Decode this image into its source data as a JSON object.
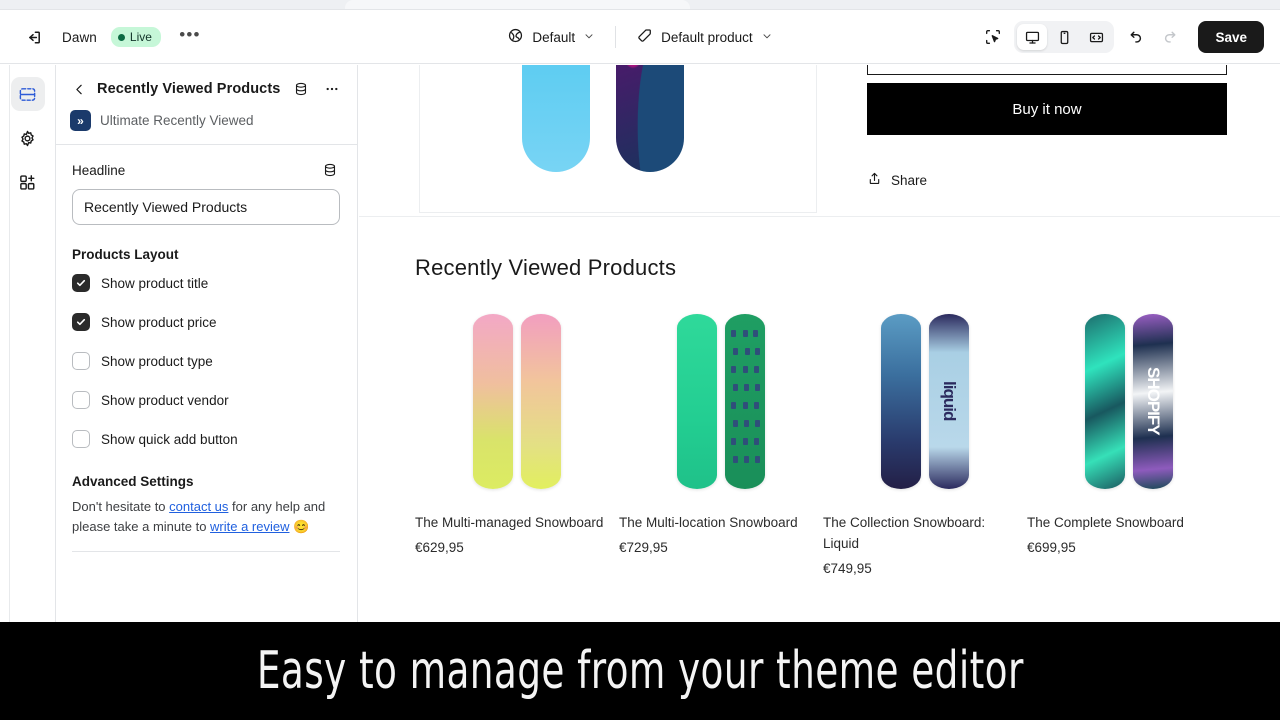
{
  "topbar": {
    "exit_icon": "exit-icon",
    "theme_name": "Dawn",
    "status_badge": "Live",
    "more_label": "•••",
    "locale_icon": "globe-icon",
    "locale_label": "Default",
    "template_icon": "tag-icon",
    "template_label": "Default product",
    "inspect_icon": "inspector-icon",
    "device_desktop_icon": "desktop-icon",
    "device_mobile_icon": "mobile-icon",
    "device_fullscreen_icon": "fullscreen-icon",
    "undo_icon": "undo-icon",
    "redo_icon": "redo-icon",
    "save_label": "Save",
    "accent_green_bg": "#c6f7d8",
    "accent_green_dot": "#0d6b43",
    "save_bg": "#1a1a1a"
  },
  "rail": {
    "items": [
      {
        "name": "sections-icon",
        "active": true
      },
      {
        "name": "settings-gear-icon",
        "active": false
      },
      {
        "name": "apps-add-icon",
        "active": false
      }
    ],
    "active_color": "#2d5bd7"
  },
  "sidebar": {
    "back_icon": "chevron-left-icon",
    "title": "Recently Viewed Products",
    "metafield_icon": "database-icon",
    "more_icon": "ellipsis-icon",
    "app_badge_glyph": "»",
    "app_name": "Ultimate Recently Viewed",
    "app_badge_color": "#1b3a6b",
    "headline": {
      "label": "Headline",
      "metafield_icon": "database-icon",
      "value": "Recently Viewed Products"
    },
    "products_layout": {
      "title": "Products Layout",
      "options": [
        {
          "label": "Show product title",
          "checked": true
        },
        {
          "label": "Show product price",
          "checked": true
        },
        {
          "label": "Show product type",
          "checked": false
        },
        {
          "label": "Show product vendor",
          "checked": false
        },
        {
          "label": "Show quick add button",
          "checked": false
        }
      ]
    },
    "advanced": {
      "title": "Advanced Settings",
      "text_1": "Don't hesitate to ",
      "link_1": "contact us",
      "text_2": " for any help and please take a minute to ",
      "link_2": "write a review",
      "emoji": " 😊",
      "link_color": "#2060df"
    }
  },
  "preview": {
    "buy_button": "Buy it now",
    "share_icon": "share-icon",
    "share_label": "Share",
    "section_heading": "Recently Viewed Products",
    "products": [
      {
        "title": "The Multi-managed Snowboard",
        "price": "€629,95",
        "art": "pink-yellow-gradient"
      },
      {
        "title": "The Multi-location Snowboard",
        "price": "€729,95",
        "art": "green-pixel-characters"
      },
      {
        "title": "The Collection Snowboard: Liquid",
        "price": "€749,95",
        "art": "blue-liquid-forest",
        "board_text": "liquid"
      },
      {
        "title": "The Complete Snowboard",
        "price": "€699,95",
        "art": "teal-purple-shopify",
        "board_text": "SHOPIFY"
      }
    ]
  },
  "caption": {
    "text": "Easy to manage from your theme editor",
    "bg": "#000000",
    "fg": "#f4f4f4"
  }
}
